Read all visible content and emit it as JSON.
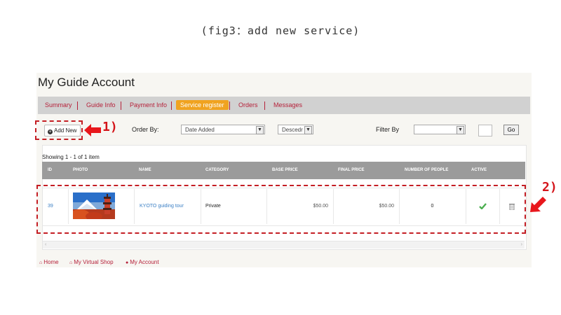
{
  "caption": "(fig3：add new service)",
  "page_title": "My Guide Account",
  "tabs": [
    "Summary",
    "Guide Info",
    "Payment Info",
    "Service register",
    "Orders",
    "Messages"
  ],
  "toolbar": {
    "add_new_label": "Add New",
    "order_by_label": "Order By:",
    "order_by_value": "Date Added",
    "direction_value": "Descedr",
    "filter_by_label": "Filter By",
    "filter_value": "",
    "go_label": "Go"
  },
  "showing_text": "Showing 1 - 1 of 1 item",
  "table": {
    "headers": [
      "ID",
      "PHOTO",
      "NAME",
      "CATEGORY",
      "BASE PRICE",
      "FINAL PRICE",
      "NUMBER OF PEOPLE",
      "ACTIVE"
    ],
    "rows": [
      {
        "id": "39",
        "name": "KYOTO guiding tour",
        "category": "Private",
        "base_price": "$50.00",
        "final_price": "$50.00",
        "people": "0",
        "active": true
      }
    ]
  },
  "footer": [
    "Home",
    "My Virtual Shop",
    "My Account"
  ],
  "annotations": [
    "1)",
    "2)"
  ],
  "colors": {
    "accent": "#f0a320",
    "link": "#b5213a",
    "callout": "#d4141a",
    "active_check": "#4caf50"
  }
}
